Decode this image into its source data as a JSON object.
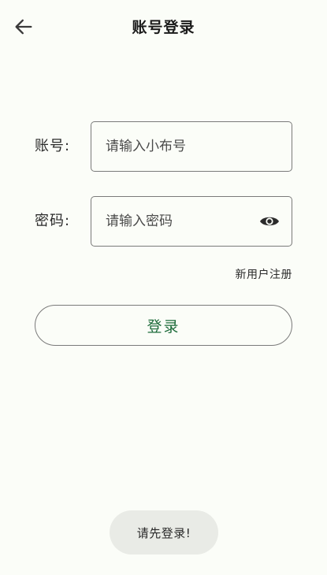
{
  "header": {
    "title": "账号登录",
    "back_icon": "arrow-left-icon"
  },
  "form": {
    "account": {
      "label": "账号:",
      "placeholder": "请输入小布号",
      "value": ""
    },
    "password": {
      "label": "密码:",
      "placeholder": "请输入密码",
      "value": "",
      "toggle_icon": "eye-icon"
    },
    "register_link": "新用户注册",
    "login_button": "登录"
  },
  "toast": {
    "message": "请先登录!"
  },
  "colors": {
    "background": "#fbfdf8",
    "accent": "#1d6b3a",
    "border": "#7a7a7a",
    "toast_bg": "#e9ebe6"
  }
}
